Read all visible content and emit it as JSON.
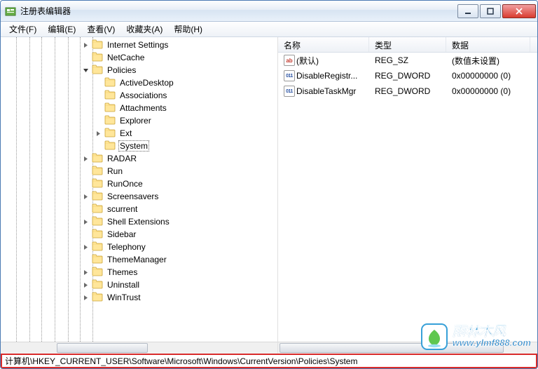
{
  "window": {
    "title": "注册表编辑器"
  },
  "menu": {
    "file": "文件(F)",
    "edit": "编辑(E)",
    "view": "查看(V)",
    "favorites": "收藏夹(A)",
    "help": "帮助(H)"
  },
  "tree": {
    "indents": [
      22,
      41,
      58,
      77,
      96,
      113,
      131
    ],
    "items": [
      {
        "level": 6,
        "label": "Internet Settings",
        "exp": "closed"
      },
      {
        "level": 6,
        "label": "NetCache",
        "exp": "none"
      },
      {
        "level": 6,
        "label": "Policies",
        "exp": "open"
      },
      {
        "level": 7,
        "label": "ActiveDesktop",
        "exp": "none"
      },
      {
        "level": 7,
        "label": "Associations",
        "exp": "none"
      },
      {
        "level": 7,
        "label": "Attachments",
        "exp": "none"
      },
      {
        "level": 7,
        "label": "Explorer",
        "exp": "none"
      },
      {
        "level": 7,
        "label": "Ext",
        "exp": "closed"
      },
      {
        "level": 7,
        "label": "System",
        "exp": "none",
        "selected": true
      },
      {
        "level": 6,
        "label": "RADAR",
        "exp": "closed"
      },
      {
        "level": 6,
        "label": "Run",
        "exp": "none"
      },
      {
        "level": 6,
        "label": "RunOnce",
        "exp": "none"
      },
      {
        "level": 6,
        "label": "Screensavers",
        "exp": "closed"
      },
      {
        "level": 6,
        "label": "scurrent",
        "exp": "none"
      },
      {
        "level": 6,
        "label": "Shell Extensions",
        "exp": "closed"
      },
      {
        "level": 6,
        "label": "Sidebar",
        "exp": "none"
      },
      {
        "level": 6,
        "label": "Telephony",
        "exp": "closed"
      },
      {
        "level": 6,
        "label": "ThemeManager",
        "exp": "none"
      },
      {
        "level": 6,
        "label": "Themes",
        "exp": "closed"
      },
      {
        "level": 6,
        "label": "Uninstall",
        "exp": "closed"
      },
      {
        "level": 6,
        "label": "WinTrust",
        "exp": "closed"
      }
    ]
  },
  "list": {
    "columns": {
      "name": "名称",
      "type": "类型",
      "data": "数据"
    },
    "colWidths": {
      "name": 130,
      "type": 110,
      "data": 120
    },
    "rows": [
      {
        "icon": "ab",
        "name": "(默认)",
        "type": "REG_SZ",
        "data": "(数值未设置)"
      },
      {
        "icon": "bin",
        "name": "DisableRegistr...",
        "type": "REG_DWORD",
        "data": "0x00000000 (0)"
      },
      {
        "icon": "bin",
        "name": "DisableTaskMgr",
        "type": "REG_DWORD",
        "data": "0x00000000 (0)"
      }
    ]
  },
  "statusbar": {
    "path": "计算机\\HKEY_CURRENT_USER\\Software\\Microsoft\\Windows\\CurrentVersion\\Policies\\System"
  },
  "watermark": {
    "cn": "雨林木风",
    "url": "www.ylmf888.com"
  }
}
